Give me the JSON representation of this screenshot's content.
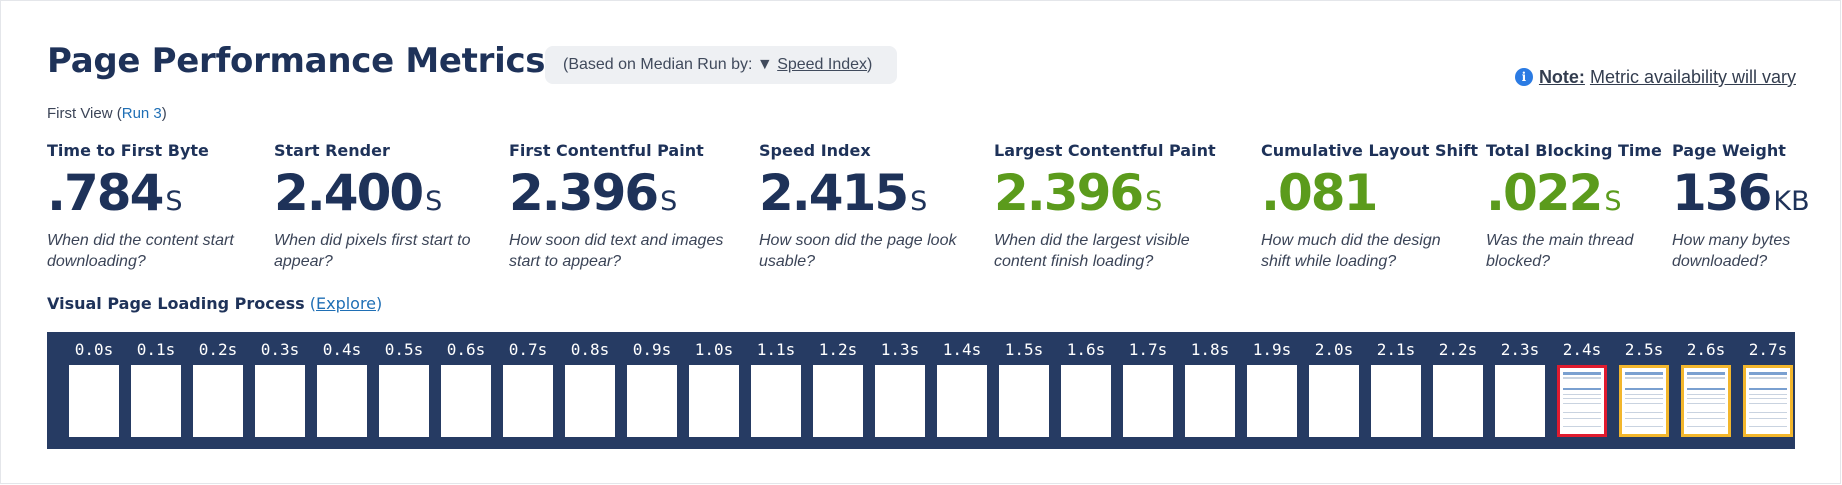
{
  "header": {
    "title": "Page Performance Metrics",
    "basis_prefix": "(Based on Median Run by: ",
    "basis_arrow": "▼",
    "basis_link": "Speed Index",
    "basis_suffix": ")",
    "note_label": "Note:",
    "note_text": "Metric availability will vary",
    "note_icon": "info-icon",
    "first_view_prefix": "First View (",
    "first_view_run": "Run 3",
    "first_view_suffix": ")"
  },
  "metrics": [
    {
      "label": "Time to First Byte",
      "value": ".784",
      "unit": "S",
      "desc": "When did the content start downloading?"
    },
    {
      "label": "Start Render",
      "value": "2.400",
      "unit": "S",
      "desc": "When did pixels first start to appear?"
    },
    {
      "label": "First Contentful Paint",
      "value": "2.396",
      "unit": "S",
      "desc": "How soon did text and images start to appear?"
    },
    {
      "label": "Speed Index",
      "value": "2.415",
      "unit": "S",
      "desc": "How soon did the page look usable?"
    },
    {
      "label": "Largest Contentful Paint",
      "value": "2.396",
      "unit": "S",
      "desc": "When did the largest visible content finish loading?"
    },
    {
      "label": "Cumulative Layout Shift",
      "value": ".081",
      "unit": "",
      "desc": "How much did the design shift while loading?"
    },
    {
      "label": "Total Blocking Time",
      "value": ".022",
      "unit": "S",
      "desc": "Was the main thread blocked?"
    },
    {
      "label": "Page Weight",
      "value": "136",
      "unit": "KB",
      "desc": "How many bytes downloaded?"
    }
  ],
  "visual": {
    "title": "Visual Page Loading Process",
    "explore_open": " (",
    "explore_label": "Explore",
    "explore_close": ")",
    "frames": [
      {
        "time": "0.0s",
        "state": "blank"
      },
      {
        "time": "0.1s",
        "state": "blank"
      },
      {
        "time": "0.2s",
        "state": "blank"
      },
      {
        "time": "0.3s",
        "state": "blank"
      },
      {
        "time": "0.4s",
        "state": "blank"
      },
      {
        "time": "0.5s",
        "state": "blank"
      },
      {
        "time": "0.6s",
        "state": "blank"
      },
      {
        "time": "0.7s",
        "state": "blank"
      },
      {
        "time": "0.8s",
        "state": "blank"
      },
      {
        "time": "0.9s",
        "state": "blank"
      },
      {
        "time": "1.0s",
        "state": "blank"
      },
      {
        "time": "1.1s",
        "state": "blank"
      },
      {
        "time": "1.2s",
        "state": "blank"
      },
      {
        "time": "1.3s",
        "state": "blank"
      },
      {
        "time": "1.4s",
        "state": "blank"
      },
      {
        "time": "1.5s",
        "state": "blank"
      },
      {
        "time": "1.6s",
        "state": "blank"
      },
      {
        "time": "1.7s",
        "state": "blank"
      },
      {
        "time": "1.8s",
        "state": "blank"
      },
      {
        "time": "1.9s",
        "state": "blank"
      },
      {
        "time": "2.0s",
        "state": "blank"
      },
      {
        "time": "2.1s",
        "state": "blank"
      },
      {
        "time": "2.2s",
        "state": "blank"
      },
      {
        "time": "2.3s",
        "state": "blank"
      },
      {
        "time": "2.4s",
        "state": "first-render"
      },
      {
        "time": "2.5s",
        "state": "changed"
      },
      {
        "time": "2.6s",
        "state": "changed"
      },
      {
        "time": "2.7s",
        "state": "changed"
      }
    ]
  },
  "colors": {
    "heading": "#1e3259",
    "good": "#5b9b1c",
    "strip": "#263b63",
    "first_render_border": "#e01b2f",
    "changed_border": "#f2b62c",
    "link": "#1f6fb5"
  }
}
